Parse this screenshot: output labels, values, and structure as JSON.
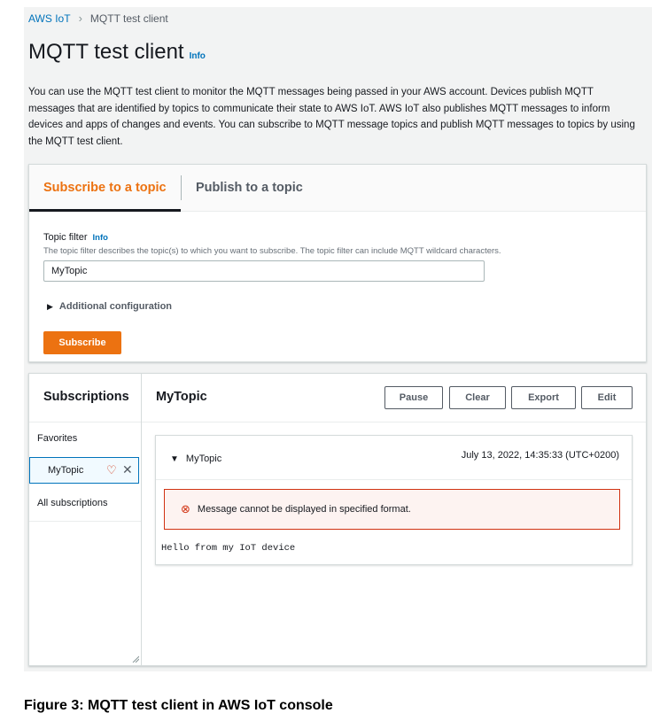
{
  "breadcrumb": {
    "root": "AWS IoT",
    "separator": "›",
    "current": "MQTT test client"
  },
  "page": {
    "title": "MQTT test client",
    "info": "Info",
    "description": "You can use the MQTT test client to monitor the MQTT messages being passed in your AWS account. Devices publish MQTT messages that are identified by topics to communicate their state to AWS IoT. AWS IoT also publishes MQTT messages to inform devices and apps of changes and events. You can subscribe to MQTT message topics and publish MQTT messages to topics by using the MQTT test client."
  },
  "tabs": [
    {
      "label": "Subscribe to a topic",
      "active": true
    },
    {
      "label": "Publish to a topic",
      "active": false
    }
  ],
  "subscribe_form": {
    "label": "Topic filter",
    "info": "Info",
    "description": "The topic filter describes the topic(s) to which you want to subscribe. The topic filter can include MQTT wildcard characters.",
    "value": "MyTopic",
    "additional_config": "Additional configuration",
    "submit_label": "Subscribe"
  },
  "subscriptions": {
    "title": "Subscriptions",
    "favorites_label": "Favorites",
    "items": [
      {
        "name": "MyTopic",
        "selected": true
      }
    ],
    "all_label": "All subscriptions"
  },
  "topic_view": {
    "title": "MyTopic",
    "buttons": {
      "pause": "Pause",
      "clear": "Clear",
      "export": "Export",
      "edit": "Edit"
    },
    "message": {
      "topic": "MyTopic",
      "timestamp": "July 13, 2022, 14:35:33 (UTC+0200)",
      "alert": "Message cannot be displayed in specified format.",
      "payload": "Hello from my IoT device"
    }
  },
  "caption": "Figure 3: MQTT test client in AWS IoT console",
  "colors": {
    "accent": "#ec7211",
    "link": "#0073bb",
    "error": "#d13212"
  },
  "icons": [
    "chevron-right-icon",
    "caret-right-icon",
    "caret-down-icon",
    "heart-icon",
    "close-icon",
    "error-icon",
    "resize-grip-icon"
  ]
}
